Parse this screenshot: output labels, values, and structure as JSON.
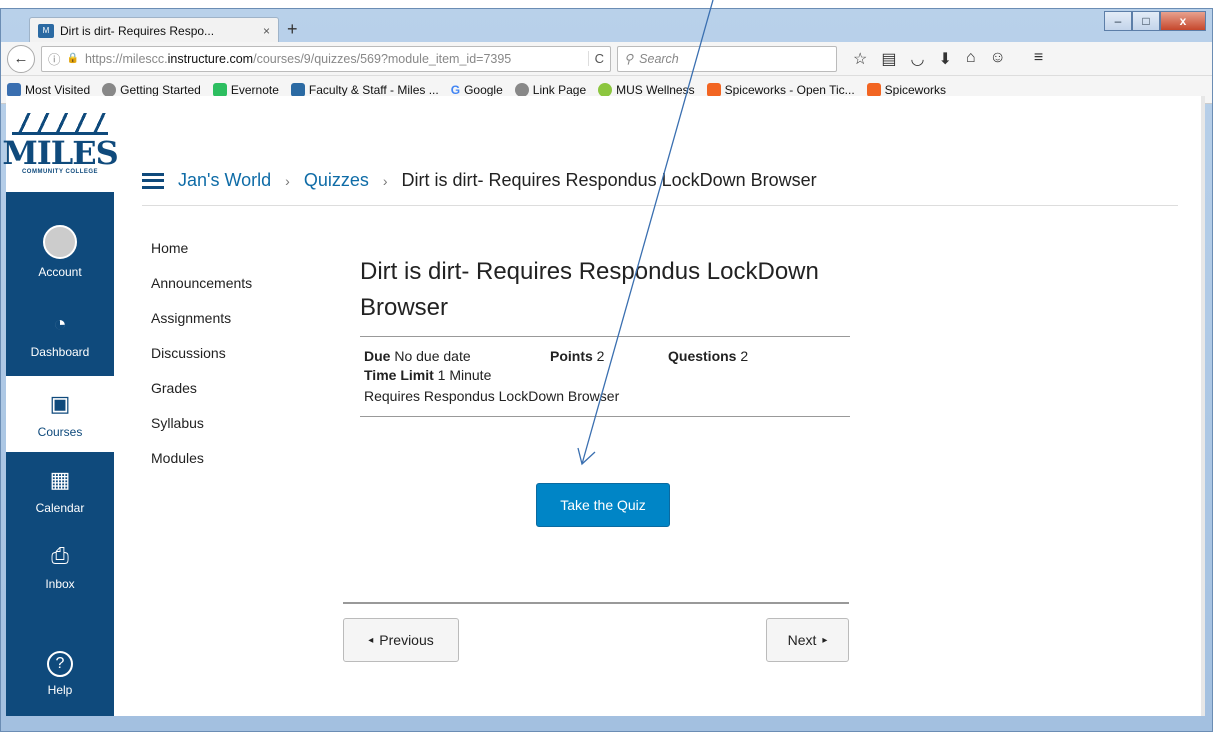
{
  "browser": {
    "tab_title": "Dirt is dirt- Requires Respo...",
    "tab_close": "×",
    "new_tab": "+",
    "win_min": "–",
    "win_max": "□",
    "win_close": "x",
    "back": "←",
    "url_info": "ⓘ",
    "url_lock": "🔒",
    "url_prefix": "https://milescc.",
    "url_host": "instructure.com",
    "url_path": "/courses/9/quizzes/569?module_item_id=7395",
    "reload": "C",
    "search_placeholder": "Search",
    "toolbar_icons": [
      "star-icon",
      "reading-list-icon",
      "pocket-icon",
      "download-icon",
      "home-icon",
      "chat-icon",
      "menu-icon"
    ]
  },
  "bookmarks": [
    {
      "label": "Most Visited",
      "color": "#3a6fb0"
    },
    {
      "label": "Getting Started",
      "color": "#888888"
    },
    {
      "label": "Evernote",
      "color": "#2dbe60"
    },
    {
      "label": "Faculty & Staff - Miles ...",
      "color": "#2b6aa3"
    },
    {
      "label": "Google",
      "color": "#4285f4"
    },
    {
      "label": "Link Page",
      "color": "#888888"
    },
    {
      "label": "MUS Wellness",
      "color": "#8cc63f"
    },
    {
      "label": "Spiceworks - Open Tic...",
      "color": "#f26522"
    },
    {
      "label": "Spiceworks",
      "color": "#f26522"
    }
  ],
  "logo": {
    "name": "MILES",
    "sub": "COMMUNITY COLLEGE"
  },
  "global_nav": {
    "account": "Account",
    "dashboard": "Dashboard",
    "courses": "Courses",
    "calendar": "Calendar",
    "inbox": "Inbox",
    "help": "Help"
  },
  "breadcrumb": {
    "course": "Jan's World",
    "section": "Quizzes",
    "current": "Dirt is dirt- Requires Respondus LockDown Browser",
    "separator": "›"
  },
  "course_nav": [
    "Home",
    "Announcements",
    "Assignments",
    "Discussions",
    "Grades",
    "Syllabus",
    "Modules"
  ],
  "quiz": {
    "title": "Dirt is dirt- Requires Respondus LockDown Browser",
    "due_label": "Due",
    "due_value": "No due date",
    "points_label": "Points",
    "points_value": "2",
    "questions_label": "Questions",
    "questions_value": "2",
    "time_limit_label": "Time Limit",
    "time_limit_value": "1 Minute",
    "requirement": "Requires Respondus LockDown Browser",
    "take_button": "Take the Quiz"
  },
  "pager": {
    "previous": "Previous",
    "next": "Next",
    "prev_arrow": "◂",
    "next_arrow": "▸"
  },
  "colors": {
    "nav_bg": "#0f4a7c",
    "link": "#0f6ca7",
    "button": "#0085c6"
  }
}
